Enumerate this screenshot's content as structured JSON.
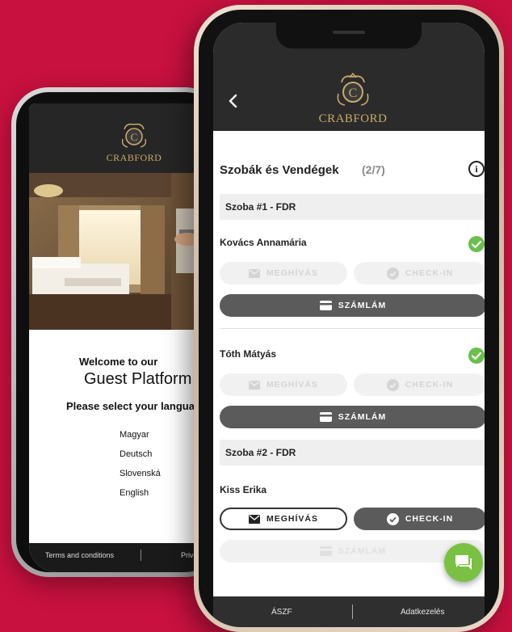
{
  "back_phone": {
    "brand": "CRABFORD",
    "welcome_line1": "Welcome to our",
    "welcome_line2": "Guest Platform",
    "select_language": "Please select your langua",
    "languages": [
      "Magyar",
      "Deutsch",
      "Slovenská",
      "English"
    ],
    "footer": {
      "terms": "Terms and conditions",
      "privacy": "Privac"
    }
  },
  "front_phone": {
    "brand": "CRABFORD",
    "back_icon": "chevron-left-icon",
    "section_title": "Szobák és Vendégek",
    "step_counter": "(2/7)",
    "info_icon": "info-icon",
    "rooms": [
      {
        "label": "Szoba #1 - FDR",
        "guests": [
          {
            "name": "Kovács Annamária",
            "checked_in": true,
            "invite_label": "MEGHÍVÁS",
            "checkin_label": "CHECK-IN",
            "bill_label": "SZÁMLÁM"
          },
          {
            "name": "Tóth Mátyás",
            "checked_in": true,
            "invite_label": "MEGHÍVÁS",
            "checkin_label": "CHECK-IN",
            "bill_label": "SZÁMLÁM"
          }
        ]
      },
      {
        "label": "Szoba #2 - FDR",
        "guests": [
          {
            "name": "Kiss Erika",
            "checked_in": false,
            "invite_label": "MEGHÍVÁS",
            "checkin_label": "CHECK-IN",
            "bill_label": "SZÁMLÁM"
          }
        ]
      }
    ],
    "footer": {
      "terms": "ÁSZF",
      "privacy": "Adatkezelés"
    },
    "chat_icon": "chat-icon"
  },
  "colors": {
    "background": "#c8113f",
    "accent_green": "#6cbf4c",
    "header_dark": "#2b2b2b",
    "gold": "#c9a96b"
  }
}
